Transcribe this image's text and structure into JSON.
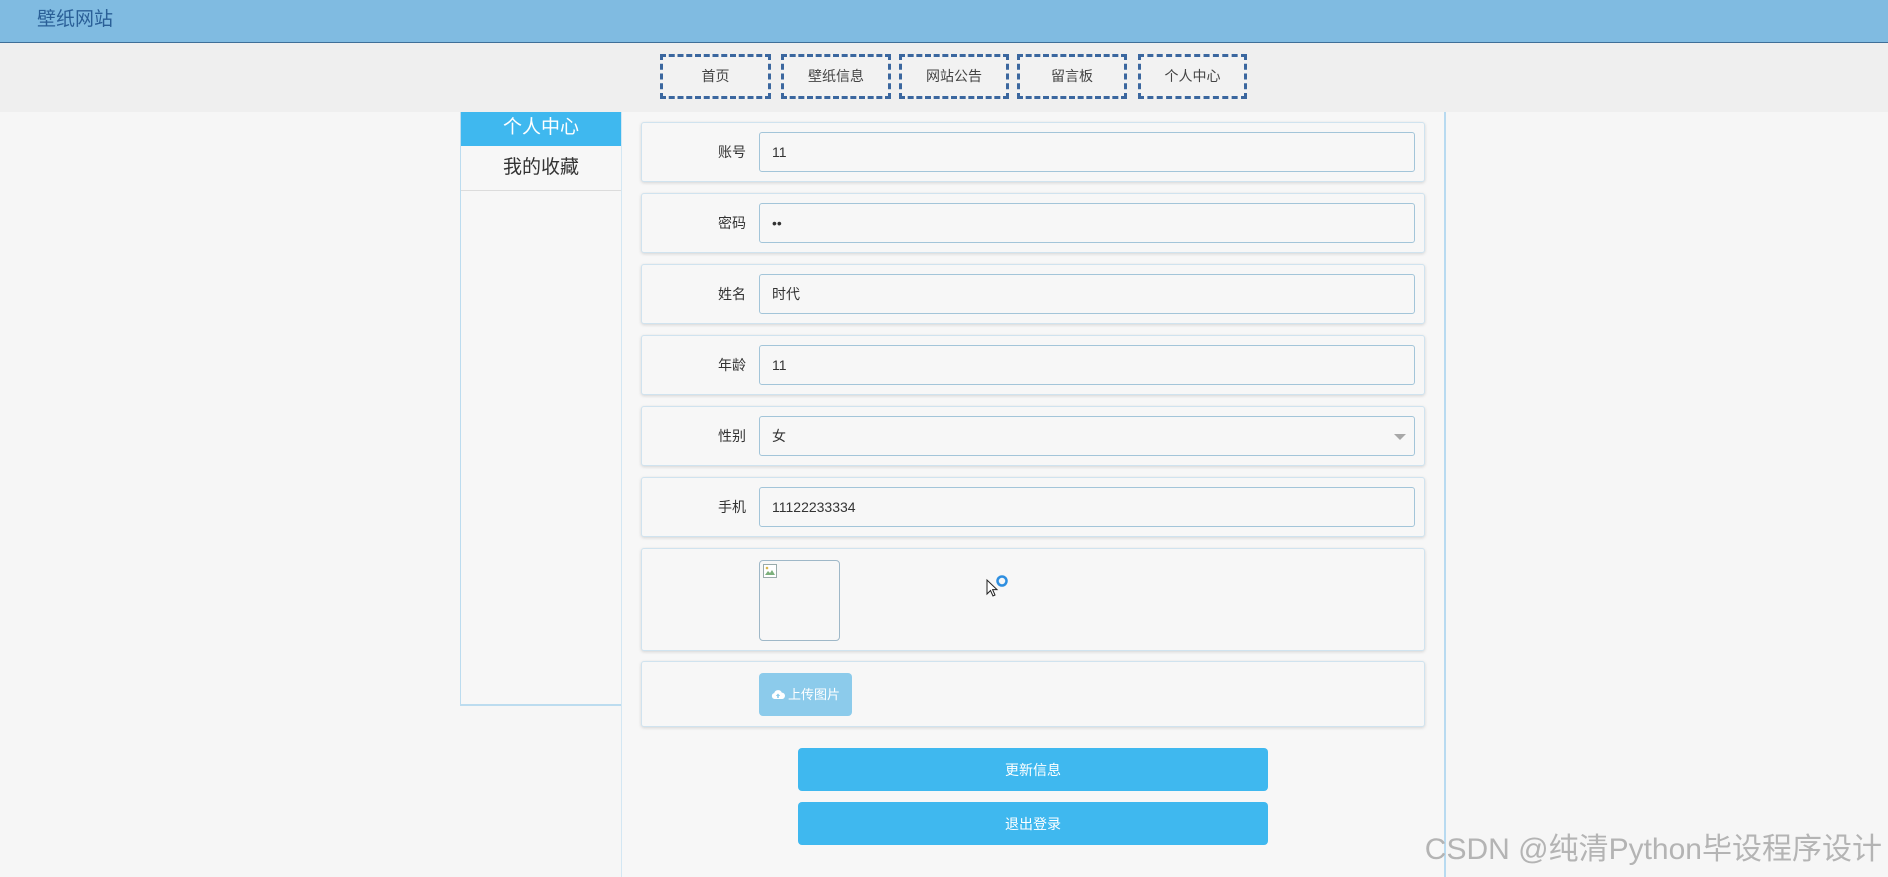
{
  "header": {
    "title": "壁纸网站"
  },
  "nav": {
    "items": [
      {
        "label": "首页"
      },
      {
        "label": "壁纸信息"
      },
      {
        "label": "网站公告"
      },
      {
        "label": "留言板"
      },
      {
        "label": "个人中心"
      }
    ]
  },
  "sidebar": {
    "items": [
      {
        "label": "个人中心",
        "active": true
      },
      {
        "label": "我的收藏",
        "active": false
      }
    ]
  },
  "form": {
    "account": {
      "label": "账号",
      "value": "11"
    },
    "password": {
      "label": "密码",
      "value": "••"
    },
    "name": {
      "label": "姓名",
      "value": "时代"
    },
    "age": {
      "label": "年龄",
      "value": "11"
    },
    "gender": {
      "label": "性别",
      "value": "女"
    },
    "phone": {
      "label": "手机",
      "value": "11122233334"
    },
    "avatar": {
      "icon": "broken-image-icon"
    },
    "upload_label": "上传图片",
    "upload_icon": "cloud-upload-icon"
  },
  "actions": {
    "update_label": "更新信息",
    "logout_label": "退出登录"
  },
  "watermark": "CSDN @纯清Python毕设程序设计",
  "colors": {
    "header_bg": "#80bbe1",
    "accent": "#3fb8ef",
    "upload_button": "#8ccbeb",
    "nav_border": "#3b679f"
  }
}
